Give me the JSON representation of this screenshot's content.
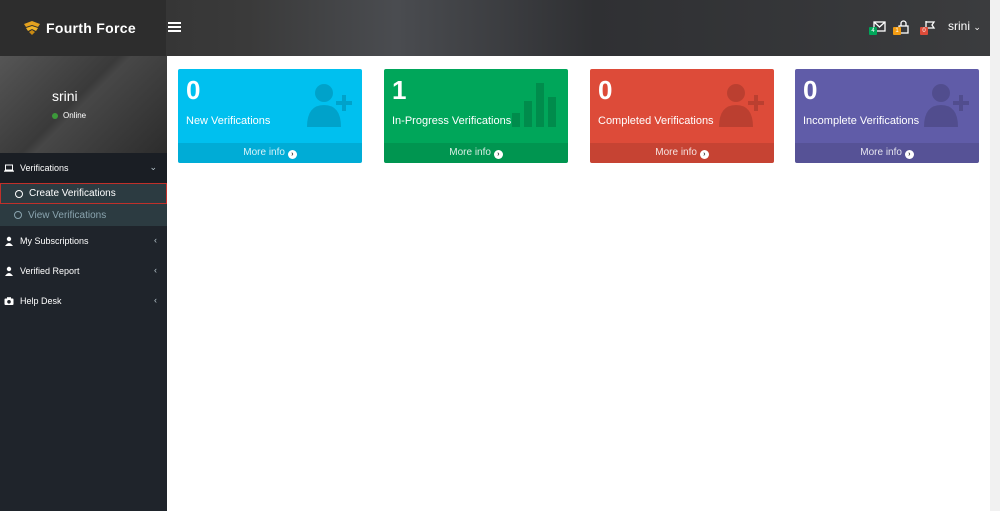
{
  "header": {
    "brand": "Fourth Force",
    "username": "srini",
    "notification_badges": [
      "4",
      "1",
      "0"
    ]
  },
  "sidebar": {
    "user": {
      "name": "srini",
      "status": "Online"
    },
    "menu": [
      {
        "label": "Verifications",
        "icon": "laptop-icon",
        "expanded": true,
        "children": [
          {
            "label": "Create Verifications",
            "current": true
          },
          {
            "label": "View Verifications",
            "current": false
          }
        ]
      },
      {
        "label": "My Subscriptions",
        "icon": "user-icon"
      },
      {
        "label": "Verified Report",
        "icon": "user-icon"
      },
      {
        "label": "Help Desk",
        "icon": "camera-icon"
      }
    ]
  },
  "boxes": [
    {
      "count": "0",
      "label": "New Verifications",
      "footer": "More info",
      "color": "#00c0ef",
      "icon": "user-plus-icon"
    },
    {
      "count": "1",
      "label": "In-Progress Verifications",
      "footer": "More info",
      "color": "#00a65a",
      "icon": "bar-chart-icon"
    },
    {
      "count": "0",
      "label": "Completed Verifications",
      "footer": "More info",
      "color": "#dd4b39",
      "icon": "user-plus-icon"
    },
    {
      "count": "0",
      "label": "Incomplete Verifications",
      "footer": "More info",
      "color": "#605ca8",
      "icon": "user-plus-icon"
    }
  ]
}
